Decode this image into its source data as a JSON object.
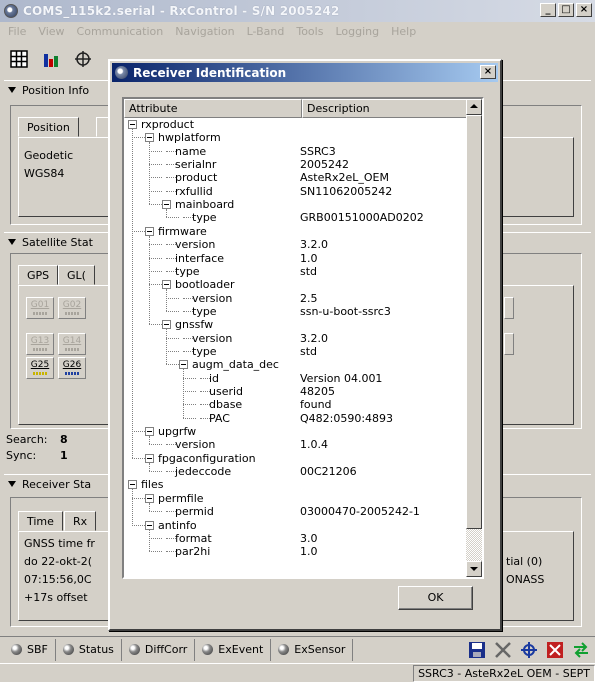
{
  "window": {
    "title": "COMS_115k2.serial - RxControl - S/N 2005242",
    "minimize": "_",
    "maximize": "□",
    "close": "×"
  },
  "menu": [
    "File",
    "View",
    "Communication",
    "Navigation",
    "L-Band",
    "Tools",
    "Logging",
    "Help"
  ],
  "panels": {
    "position": {
      "header": "Position Info",
      "tab": "Position",
      "line1": "Geodetic",
      "line2": "WGS84"
    },
    "satellite": {
      "header": "Satellite Stat",
      "tab_gps": "GPS",
      "tab_glo": "GL(",
      "sat_row1": [
        "G01",
        "G02"
      ],
      "sat_row2": [
        "G13",
        "G14"
      ],
      "sat_row3": [
        "G25",
        "G26"
      ],
      "search_label": "Search:",
      "search_value": "8",
      "sync_label": "Sync:",
      "sync_value": "1"
    },
    "receiver": {
      "header": "Receiver Sta",
      "tab_time": "Time",
      "tab_rx": "Rx",
      "line1": "GNSS time fr",
      "line2": "do 22-okt-2(",
      "line3": "07:15:56,0C",
      "line4": "+17s offset",
      "right1": "tial (0)",
      "right2": "ONASS"
    }
  },
  "bottom_tabs": [
    "SBF",
    "Status",
    "DiffCorr",
    "ExEvent",
    "ExSensor"
  ],
  "status_text": "SSRC3 - AsteRx2eL OEM - SEPT",
  "dialog": {
    "title": "Receiver Identification",
    "close": "×",
    "col_attribute": "Attribute",
    "col_description": "Description",
    "ok_label": "OK",
    "rows": [
      {
        "attr": "rxproduct",
        "desc": ""
      },
      {
        "attr": "hwplatform",
        "desc": ""
      },
      {
        "attr": "name",
        "desc": "SSRC3"
      },
      {
        "attr": "serialnr",
        "desc": "2005242"
      },
      {
        "attr": "product",
        "desc": "AsteRx2eL_OEM"
      },
      {
        "attr": "rxfullid",
        "desc": "SN11062005242"
      },
      {
        "attr": "mainboard",
        "desc": ""
      },
      {
        "attr": "type",
        "desc": "GRB00151000AD0202"
      },
      {
        "attr": "firmware",
        "desc": ""
      },
      {
        "attr": "version",
        "desc": "3.2.0"
      },
      {
        "attr": "interface",
        "desc": "1.0"
      },
      {
        "attr": "type",
        "desc": "std"
      },
      {
        "attr": "bootloader",
        "desc": ""
      },
      {
        "attr": "version",
        "desc": "2.5"
      },
      {
        "attr": "type",
        "desc": "ssn-u-boot-ssrc3"
      },
      {
        "attr": "gnssfw",
        "desc": ""
      },
      {
        "attr": "version",
        "desc": "3.2.0"
      },
      {
        "attr": "type",
        "desc": "std"
      },
      {
        "attr": "augm_data_dec",
        "desc": ""
      },
      {
        "attr": "id",
        "desc": "Version 04.001"
      },
      {
        "attr": "userid",
        "desc": "48205"
      },
      {
        "attr": "dbase",
        "desc": "found"
      },
      {
        "attr": "PAC",
        "desc": "Q482:0590:4893"
      },
      {
        "attr": "upgrfw",
        "desc": ""
      },
      {
        "attr": "version",
        "desc": "1.0.4"
      },
      {
        "attr": "fpgaconfiguration",
        "desc": ""
      },
      {
        "attr": "jedeccode",
        "desc": "00C21206"
      },
      {
        "attr": "files",
        "desc": ""
      },
      {
        "attr": "permfile",
        "desc": ""
      },
      {
        "attr": "permid",
        "desc": "03000470-2005242-1"
      },
      {
        "attr": "antinfo",
        "desc": ""
      },
      {
        "attr": "format",
        "desc": "3.0"
      },
      {
        "attr": "par2hi",
        "desc": "1.0"
      }
    ]
  }
}
